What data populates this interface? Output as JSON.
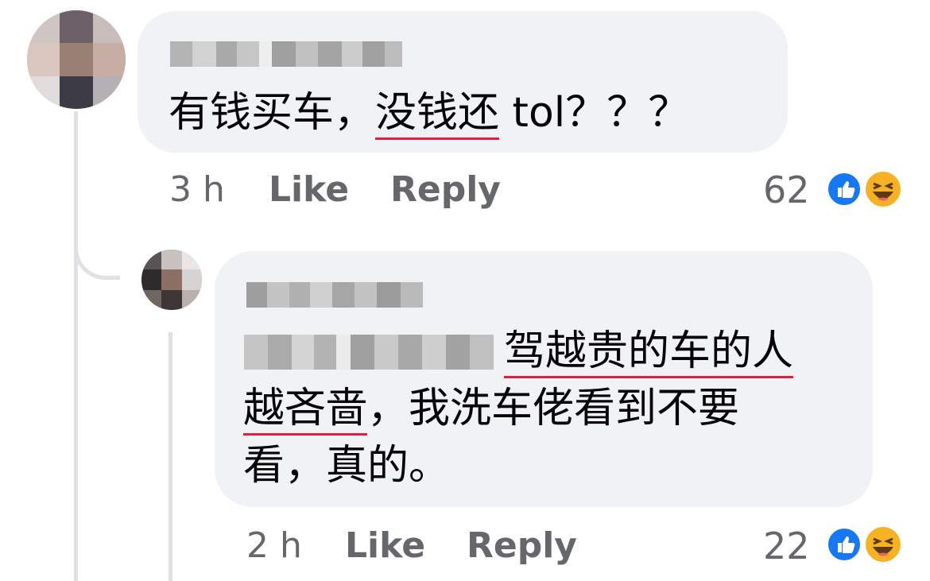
{
  "comments": [
    {
      "name": "Oleg Mokhov",
      "text_plain": "有钱买车，",
      "text_underlined": "没钱还",
      "text_after": " tol？？？",
      "time": "3 h",
      "like_label": "Like",
      "reply_label": "Reply",
      "reaction_count": "62",
      "reactions": [
        "like-icon",
        "haha-icon"
      ]
    },
    {
      "name": "koonkan",
      "mention": "Oleg Mokhov",
      "line1_underlined": "驾越贵的车的人",
      "line2_underlined": "越吝啬",
      "line2_after": "，我洗车佬看到不要",
      "line3": "看，真的。",
      "time": "2 h",
      "like_label": "Like",
      "reply_label": "Reply",
      "reaction_count": "22",
      "reactions": [
        "like-icon",
        "haha-icon"
      ]
    }
  ],
  "colors": {
    "bubble": "#f0f2f5",
    "underline": "#e41e3f",
    "meta_text": "#65676b",
    "like_blue": "#1877f2",
    "haha_yellow": "#f7b125"
  }
}
